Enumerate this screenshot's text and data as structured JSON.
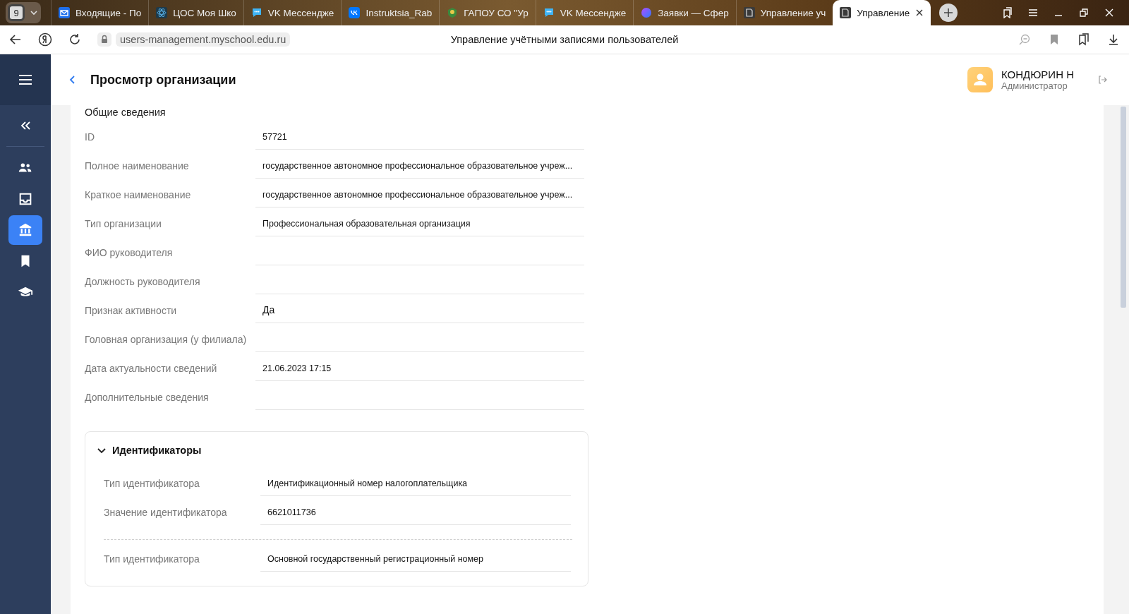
{
  "browser": {
    "tab_count": "9",
    "tabs": [
      {
        "title": "Входящие - По",
        "selected": false
      },
      {
        "title": "ЦОС Моя Шко",
        "selected": false
      },
      {
        "title": "VK Мессендже",
        "selected": false
      },
      {
        "title": "Instruktsia_Rab",
        "selected": false
      },
      {
        "title": "ГАПОУ СО \"Ур",
        "selected": false
      },
      {
        "title": "VK Мессендже",
        "selected": false
      },
      {
        "title": "Заявки — Сфер",
        "selected": false
      },
      {
        "title": "Управление уч",
        "selected": false
      },
      {
        "title": "Управление",
        "selected": true
      }
    ],
    "address": "users-management.myschool.edu.ru",
    "page_title": "Управление учётными записями пользователей"
  },
  "sidebar": {
    "items": [
      {
        "selected": false
      },
      {
        "selected": false
      },
      {
        "selected": true
      },
      {
        "selected": false
      },
      {
        "selected": false
      }
    ]
  },
  "header": {
    "title": "Просмотр организации",
    "user_name": "КОНДЮРИН Н",
    "user_role": "Администратор"
  },
  "section_title": "Общие сведения",
  "fields": [
    {
      "label": "ID",
      "value": "57721"
    },
    {
      "label": "Полное наименование",
      "value": "государственное автономное профессиональное образовательное учреж..."
    },
    {
      "label": "Краткое наименование",
      "value": "государственное автономное профессиональное образовательное учреж..."
    },
    {
      "label": "Тип организации",
      "value": "Профессиональная образовательная организация"
    },
    {
      "label": "ФИО руководителя"
    },
    {
      "label": "Должность руководителя"
    },
    {
      "label": "Признак активности",
      "value": "Да"
    },
    {
      "label": "Головная организация (у филиала)"
    },
    {
      "label": "Дата актуальности сведений",
      "value": "21.06.2023 17:15"
    },
    {
      "label": "Дополнительные сведения"
    }
  ],
  "identifiers": {
    "title": "Идентификаторы",
    "expanded": true,
    "groups": [
      {
        "rows": [
          {
            "label": "Тип идентификатора",
            "value": "Идентификационный номер налогоплательщика"
          },
          {
            "label": "Значение идентификатора",
            "value": "6621011736"
          }
        ]
      },
      {
        "rows": [
          {
            "label": "Тип идентификатора",
            "value": "Основной государственный регистрационный номер"
          }
        ]
      }
    ]
  }
}
